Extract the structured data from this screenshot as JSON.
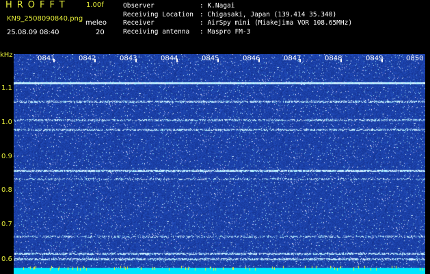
{
  "header": {
    "app_name": "HROFFT",
    "version": "1.00f",
    "filename": "KN9_2508090840.png",
    "timestamp": "25.08.09 08:40",
    "meleo_label": "meleo",
    "meleo_value": "20"
  },
  "station_info": [
    {
      "label": "Observer",
      "value": ": K.Nagai"
    },
    {
      "label": "Receiving Location",
      "value": ": Chigasaki, Japan (139.414 35.340)"
    },
    {
      "label": "Receiver",
      "value": ": AirSpy mini (Miakejima VOR 108.65MHz)"
    },
    {
      "label": "Receiving antenna",
      "value": ": Maspro FM-3"
    }
  ],
  "spectrogram": {
    "freq_unit": "kHz",
    "y_tick_labels": [
      "1.1",
      "1.0",
      "0.9",
      "0.8",
      "0.7",
      "0.6"
    ],
    "time_labels": [
      "0841",
      "0842",
      "0843",
      "0844",
      "0845",
      "0846",
      "0847",
      "0848",
      "0849",
      "0850"
    ],
    "colors": {
      "background": "#000000",
      "noise": "#1a2a9c",
      "signal": "#9ee8ff",
      "baseline": "#00e5ff",
      "text": "#e6ee3a"
    }
  }
}
